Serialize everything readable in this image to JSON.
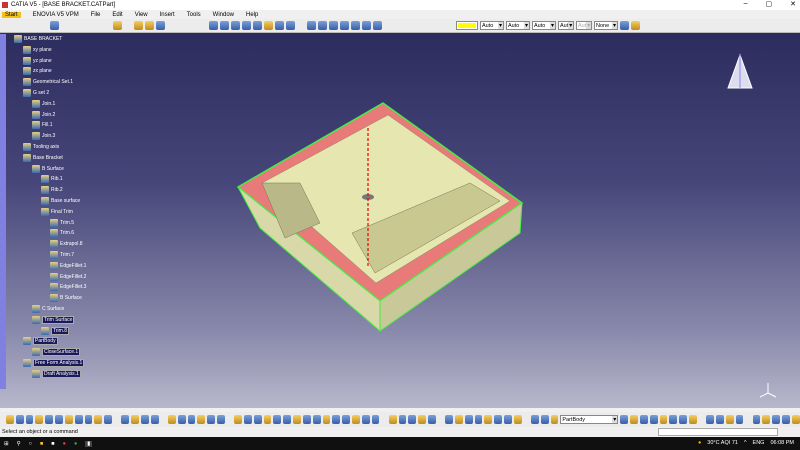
{
  "window": {
    "title": "CATIA V5 - [BASE BRACKET.CATPart]",
    "controls": [
      "–",
      "▢",
      "✕"
    ]
  },
  "menu": [
    "Start",
    "ENOVIA V5 VPM",
    "File",
    "Edit",
    "View",
    "Insert",
    "Tools",
    "Window",
    "Help"
  ],
  "properties_toolbar": {
    "color": "#ffff00",
    "selects": [
      "Auto",
      "Auto",
      "Auto",
      "Aut",
      "Aut",
      "None"
    ]
  },
  "tree": [
    {
      "label": "BASE BRACKET",
      "level": 0
    },
    {
      "label": "xy plane",
      "level": 1
    },
    {
      "label": "yz plane",
      "level": 1
    },
    {
      "label": "zx plane",
      "level": 1
    },
    {
      "label": "Geometrical Set.1",
      "level": 1
    },
    {
      "label": "G set 2",
      "level": 1
    },
    {
      "label": "Join.1",
      "level": 2
    },
    {
      "label": "Join.2",
      "level": 2
    },
    {
      "label": "Fill.1",
      "level": 2
    },
    {
      "label": "Join.3",
      "level": 2
    },
    {
      "label": "Tooling axis",
      "level": 1
    },
    {
      "label": "Base Bracket",
      "level": 1
    },
    {
      "label": "B Surface",
      "level": 2
    },
    {
      "label": "Rib.1",
      "level": 3
    },
    {
      "label": "Rib.2",
      "level": 3
    },
    {
      "label": "Base surface",
      "level": 3
    },
    {
      "label": "Final Trim",
      "level": 3
    },
    {
      "label": "Trim.5",
      "level": 4
    },
    {
      "label": "Trim.6",
      "level": 4
    },
    {
      "label": "Extrapol.8",
      "level": 4
    },
    {
      "label": "Trim.7",
      "level": 4
    },
    {
      "label": "EdgeFillet.1",
      "level": 4
    },
    {
      "label": "EdgeFillet.2",
      "level": 4
    },
    {
      "label": "EdgeFillet.3",
      "level": 4
    },
    {
      "label": "B Surface",
      "level": 4
    },
    {
      "label": "C Surface",
      "level": 2
    },
    {
      "label": "Trim Surface",
      "level": 2,
      "hl": true
    },
    {
      "label": "Trim.8",
      "level": 3,
      "hl": true
    },
    {
      "label": "PartBody",
      "level": 1,
      "hl": true
    },
    {
      "label": "CloseSurface.1",
      "level": 2,
      "hl": true
    },
    {
      "label": "Free Form Analysis.1",
      "level": 1,
      "hl": true
    },
    {
      "label": "Draft Analysis.1",
      "level": 2,
      "hl": true
    }
  ],
  "bottom_toolbar": {
    "body_select": "PartBody"
  },
  "status": {
    "message": "Select an object or a command"
  },
  "taskbar": {
    "weather": "30°C AQI 71",
    "lang": "ENG",
    "time": "06:08 PM"
  }
}
